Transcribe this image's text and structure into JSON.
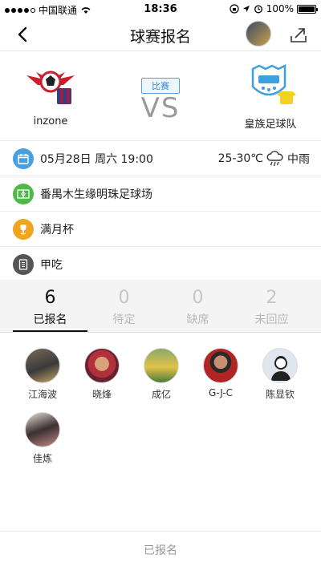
{
  "status_bar": {
    "carrier": "中国联通",
    "time": "18:36",
    "battery": "100%",
    "battery_level": 1.0
  },
  "nav": {
    "title": "球赛报名"
  },
  "match": {
    "home_team": "inzone",
    "away_team": "皇族足球队",
    "tag": "比赛",
    "vs": "VS"
  },
  "info": {
    "datetime": "05月28日 周六 19:00",
    "temperature": "25-30℃",
    "weather": "中雨",
    "venue": "番禺木生缘明珠足球场",
    "cup": "满月杯",
    "meal": "甲吃"
  },
  "stats": [
    {
      "count": "6",
      "label": "已报名"
    },
    {
      "count": "0",
      "label": "待定"
    },
    {
      "count": "0",
      "label": "缺席"
    },
    {
      "count": "2",
      "label": "未回应"
    }
  ],
  "players": [
    {
      "name": "江海波"
    },
    {
      "name": "晓烽"
    },
    {
      "name": "成亿"
    },
    {
      "name": "G-J-C"
    },
    {
      "name": "陈显钦"
    },
    {
      "name": "佳炼"
    }
  ],
  "footer": {
    "label": "已报名"
  },
  "colors": {
    "calendar": "#4a9fe0",
    "venue": "#4fb84a",
    "cup": "#f0a421",
    "meal": "#555555",
    "vs_tag": "#3b86c8"
  }
}
